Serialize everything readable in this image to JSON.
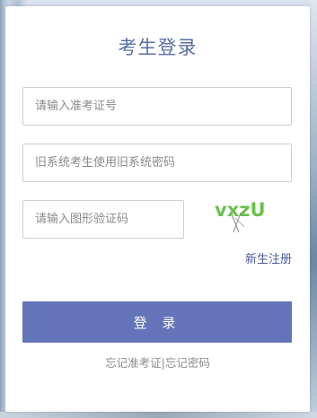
{
  "login": {
    "title": "考生登录",
    "exam_id_placeholder": "请输入准考证号",
    "password_placeholder": "旧系统考生使用旧系统密码",
    "captcha_placeholder": "请输入图形验证码",
    "captcha_text": "vxzU",
    "register_link": "新生注册",
    "login_button": "登 录",
    "forgot_exam_id": "忘记准考证",
    "separator": "|",
    "forgot_password": "忘记密码"
  },
  "colors": {
    "title": "#5a6ea6",
    "button": "#6374b8",
    "link": "#4a5d99",
    "captcha": "#6ac14c"
  }
}
